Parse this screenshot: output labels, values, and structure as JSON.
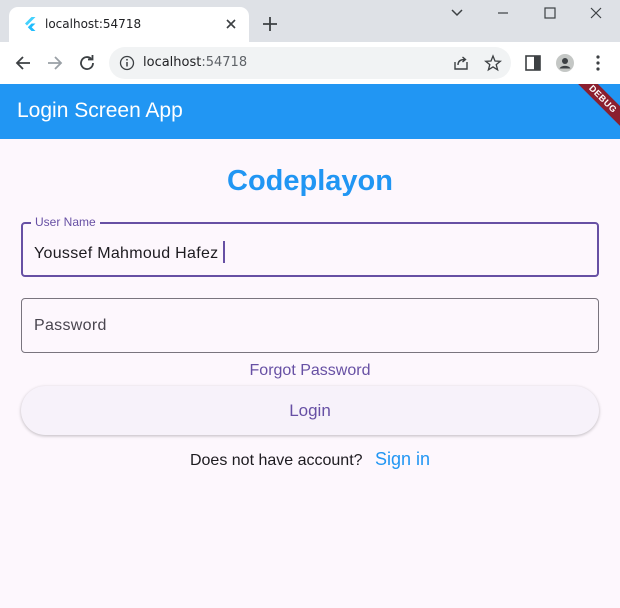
{
  "browser": {
    "tab_title": "localhost:54718",
    "url_host": "localhost",
    "url_port": ":54718"
  },
  "app": {
    "title": "Login Screen App",
    "debug_banner": "DEBUG",
    "brand": "Codeplayon",
    "username": {
      "label": "User Name",
      "value": "Youssef Mahmoud Hafez"
    },
    "password": {
      "placeholder": "Password"
    },
    "forgot_password": "Forgot Password",
    "login_button": "Login",
    "no_account_text": "Does not have account?",
    "sign_in_link": "Sign in"
  },
  "colors": {
    "appbar": "#2196f3",
    "accent": "#6750a4",
    "debug": "#8b1f2f"
  }
}
